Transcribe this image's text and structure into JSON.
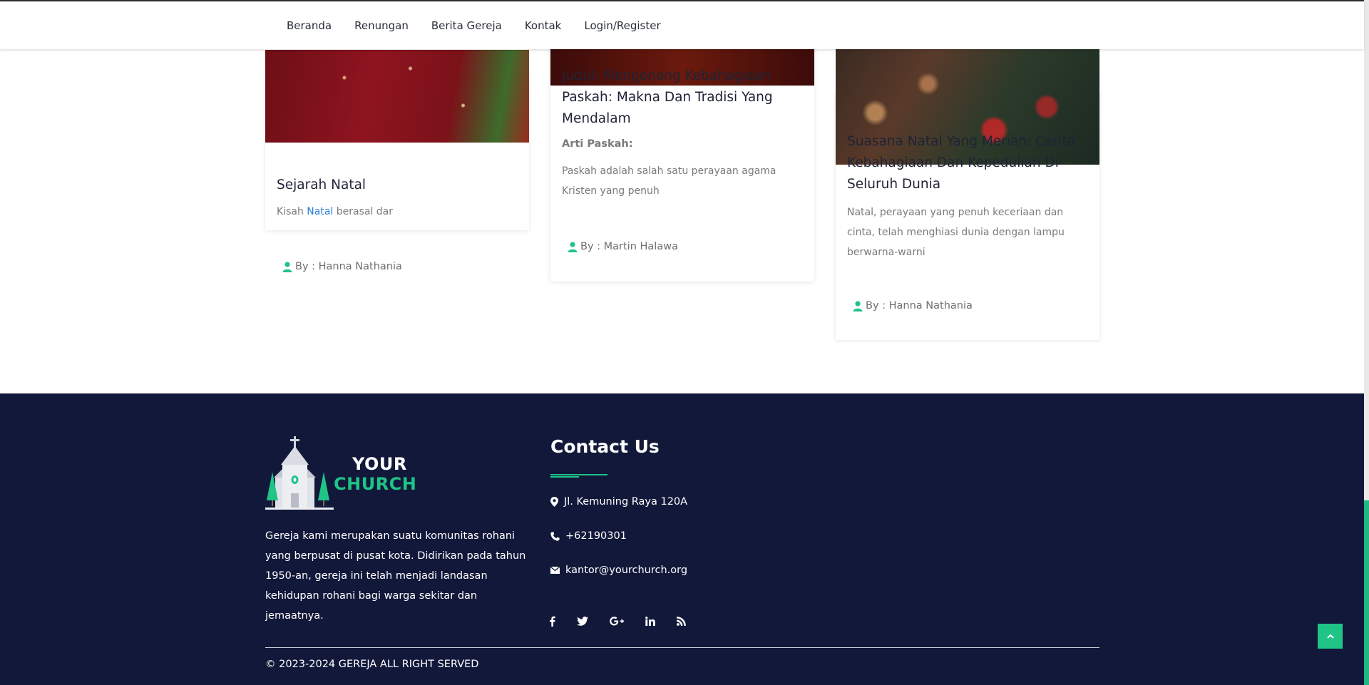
{
  "nav": {
    "items": [
      "Beranda",
      "Renungan",
      "Berita Gereja",
      "Kontak",
      "Login/Register"
    ]
  },
  "posts": [
    {
      "title": "Sejarah Natal",
      "excerpt_before": "Kisah ",
      "excerpt_link": "Natal",
      "excerpt_after": " berasal dar",
      "author": "By : Hanna Nathania"
    },
    {
      "title": "Judul: Mengenang Kebahagiaan Paskah: Makna Dan Tradisi Yang Mendalam",
      "subheading": "Arti Paskah:",
      "excerpt": "Paskah adalah salah satu perayaan agama Kristen yang penuh",
      "author": "By : Martin Halawa"
    },
    {
      "title": "Suasana Natal Yang Meriah: Cerita Kebahagiaan Dan Kepedulian Di Seluruh Dunia",
      "excerpt": "Natal, perayaan yang penuh keceriaan dan cinta, telah menghiasi dunia dengan lampu berwarna-warni",
      "author": "By : Hanna Nathania"
    }
  ],
  "footer": {
    "logo_line1": "YOUR",
    "logo_line2": "CHURCH",
    "about": "Gereja kami merupakan suatu komunitas rohani yang berpusat di pusat kota. Didirikan pada tahun 1950-an, gereja ini telah menjadi landasan kehidupan rohani bagi warga sekitar dan jemaatnya.",
    "contact_title": "Contact Us",
    "address": "Jl. Kemuning Raya 120A",
    "phone": "+62190301",
    "email": "kantor@yourchurch.org",
    "socials": [
      "facebook-icon",
      "twitter-icon",
      "google-plus-icon",
      "linkedin-icon",
      "rss-icon"
    ],
    "copyright": "© 2023-2024 GEREJA ALL RIGHT SERVED"
  },
  "colors": {
    "footer_bg": "#11183a",
    "accent": "#1fc486",
    "link": "#2d7fd3"
  }
}
